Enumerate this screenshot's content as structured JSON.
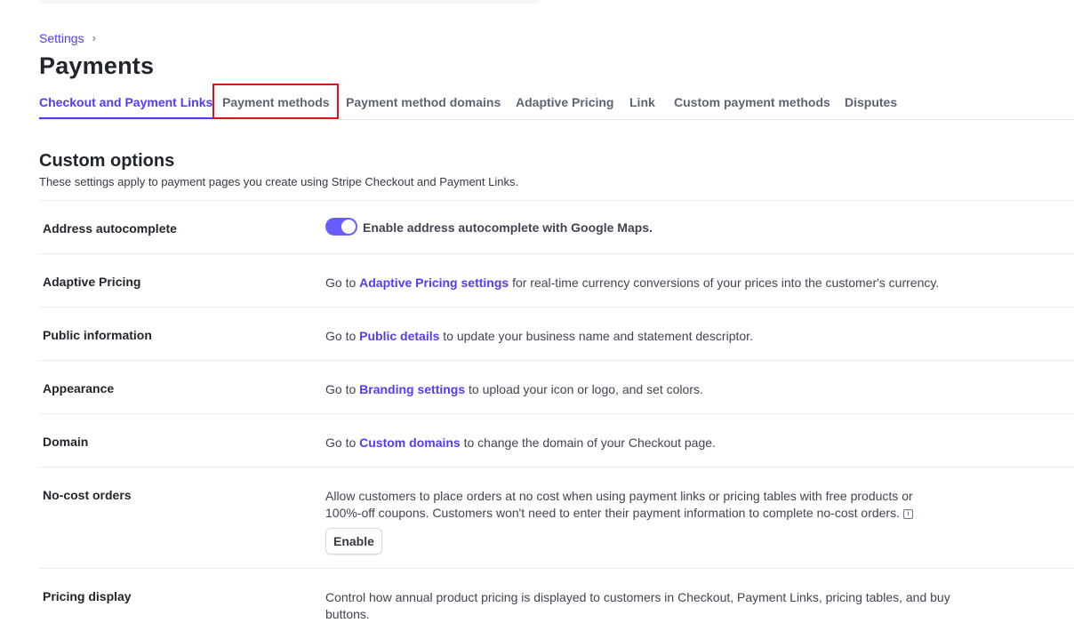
{
  "breadcrumb": {
    "parent": "Settings"
  },
  "page": {
    "title": "Payments"
  },
  "tabs": [
    {
      "label": "Checkout and Payment Links",
      "active": true
    },
    {
      "label": "Payment methods",
      "active": false
    },
    {
      "label": "Payment method domains",
      "active": false
    },
    {
      "label": "Adaptive Pricing",
      "active": false
    },
    {
      "label": "Link",
      "active": false
    },
    {
      "label": "Custom payment methods",
      "active": false
    },
    {
      "label": "Disputes",
      "active": false
    }
  ],
  "section": {
    "title": "Custom options",
    "subtitle": "These settings apply to payment pages you create using Stripe Checkout and Payment Links."
  },
  "rows": {
    "address": {
      "label": "Address autocomplete",
      "toggle_label": "Enable address autocomplete with Google Maps.",
      "enabled": true
    },
    "adaptive": {
      "label": "Adaptive Pricing",
      "pre": "Go to ",
      "link": "Adaptive Pricing settings",
      "post": " for real-time currency conversions of your prices into the customer's currency."
    },
    "public": {
      "label": "Public information",
      "pre": "Go to ",
      "link": "Public details",
      "post": " to update your business name and statement descriptor."
    },
    "appearance": {
      "label": "Appearance",
      "pre": "Go to ",
      "link": "Branding settings",
      "post": " to upload your icon or logo, and set colors."
    },
    "domain": {
      "label": "Domain",
      "pre": "Go to ",
      "link": "Custom domains",
      "post": " to change the domain of your Checkout page."
    },
    "nocost": {
      "label": "No-cost orders",
      "text": "Allow customers to place orders at no cost when using payment links or pricing tables with free products or 100%-off coupons. Customers won't need to enter their payment information to complete no-cost orders.",
      "button": "Enable"
    },
    "pricing": {
      "label": "Pricing display",
      "text": "Control how annual product pricing is displayed to customers in Checkout, Payment Links, pricing tables, and buy buttons."
    }
  },
  "colors": {
    "accent": "#533afd",
    "highlight": "#e0121d",
    "toggle_on": "#675dff"
  }
}
